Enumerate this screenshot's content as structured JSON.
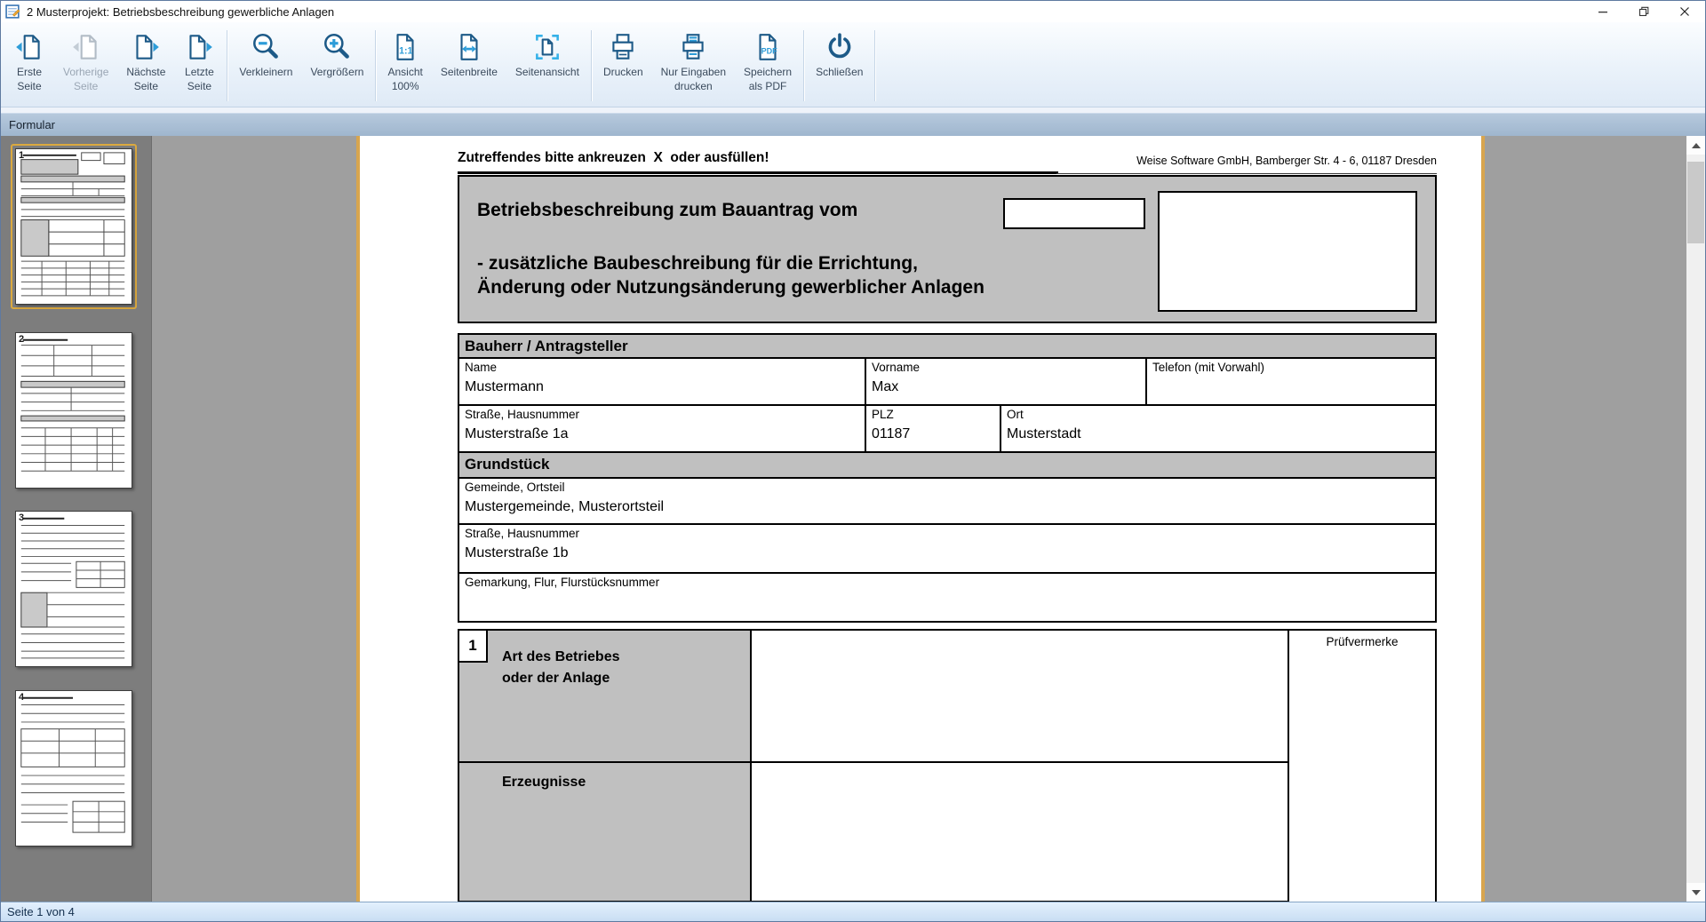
{
  "window": {
    "title": "2 Musterprojekt: Betriebsbeschreibung gewerbliche Anlagen"
  },
  "toolbar": {
    "buttons": [
      {
        "label": "Erste\nSeite",
        "disabled": false
      },
      {
        "label": "Vorherige\nSeite",
        "disabled": true
      },
      {
        "label": "Nächste\nSeite",
        "disabled": false
      },
      {
        "label": "Letzte\nSeite",
        "disabled": false
      },
      {
        "label": "Verkleinern",
        "disabled": false
      },
      {
        "label": "Vergrößern",
        "disabled": false
      },
      {
        "label": "Ansicht\n100%",
        "disabled": false
      },
      {
        "label": "Seitenbreite",
        "disabled": false
      },
      {
        "label": "Seitenansicht",
        "disabled": false
      },
      {
        "label": "Drucken",
        "disabled": false
      },
      {
        "label": "Nur Eingaben\ndrucken",
        "disabled": false
      },
      {
        "label": "Speichern\nals PDF",
        "disabled": false
      },
      {
        "label": "Schließen",
        "disabled": false
      }
    ]
  },
  "form_bar": {
    "label": "Formular"
  },
  "thumbnails": [
    {
      "number": "1",
      "selected": true
    },
    {
      "number": "2",
      "selected": false
    },
    {
      "number": "3",
      "selected": false
    },
    {
      "number": "4",
      "selected": false
    }
  ],
  "document": {
    "instruction": "Zutreffendes bitte ankreuzen  X  oder ausfüllen!",
    "vendor": "Weise Software GmbH, Bamberger Str. 4 - 6, 01187 Dresden",
    "title": "Betriebsbeschreibung zum Bauantrag vom",
    "subtitle1": "- zusätzliche Baubeschreibung für die Errichtung,",
    "subtitle2": "Änderung oder Nutzungsänderung gewerblicher Anlagen",
    "bauherr": {
      "heading": "Bauherr / Antragsteller",
      "name_label": "Name",
      "name_value": "Mustermann",
      "vorname_label": "Vorname",
      "vorname_value": "Max",
      "telefon_label": "Telefon (mit Vorwahl)",
      "telefon_value": "",
      "strasse_label": "Straße, Hausnummer",
      "strasse_value": "Musterstraße 1a",
      "plz_label": "PLZ",
      "plz_value": "01187",
      "ort_label": "Ort",
      "ort_value": "Musterstadt"
    },
    "grundstueck": {
      "heading": "Grundstück",
      "gemeinde_label": "Gemeinde, Ortsteil",
      "gemeinde_value": "Mustergemeinde, Musterortsteil",
      "strasse_label": "Straße, Hausnummer",
      "strasse_value": "Musterstraße 1b",
      "gemarkung_label": "Gemarkung, Flur, Flurstücksnummer",
      "gemarkung_value": ""
    },
    "item1": {
      "number": "1",
      "label": "Art des Betriebes\noder der Anlage",
      "pruefvermerke": "Prüfvermerke"
    },
    "erzeugnisse_label": "Erzeugnisse"
  },
  "status_bar": {
    "text": "Seite 1 von 4"
  }
}
